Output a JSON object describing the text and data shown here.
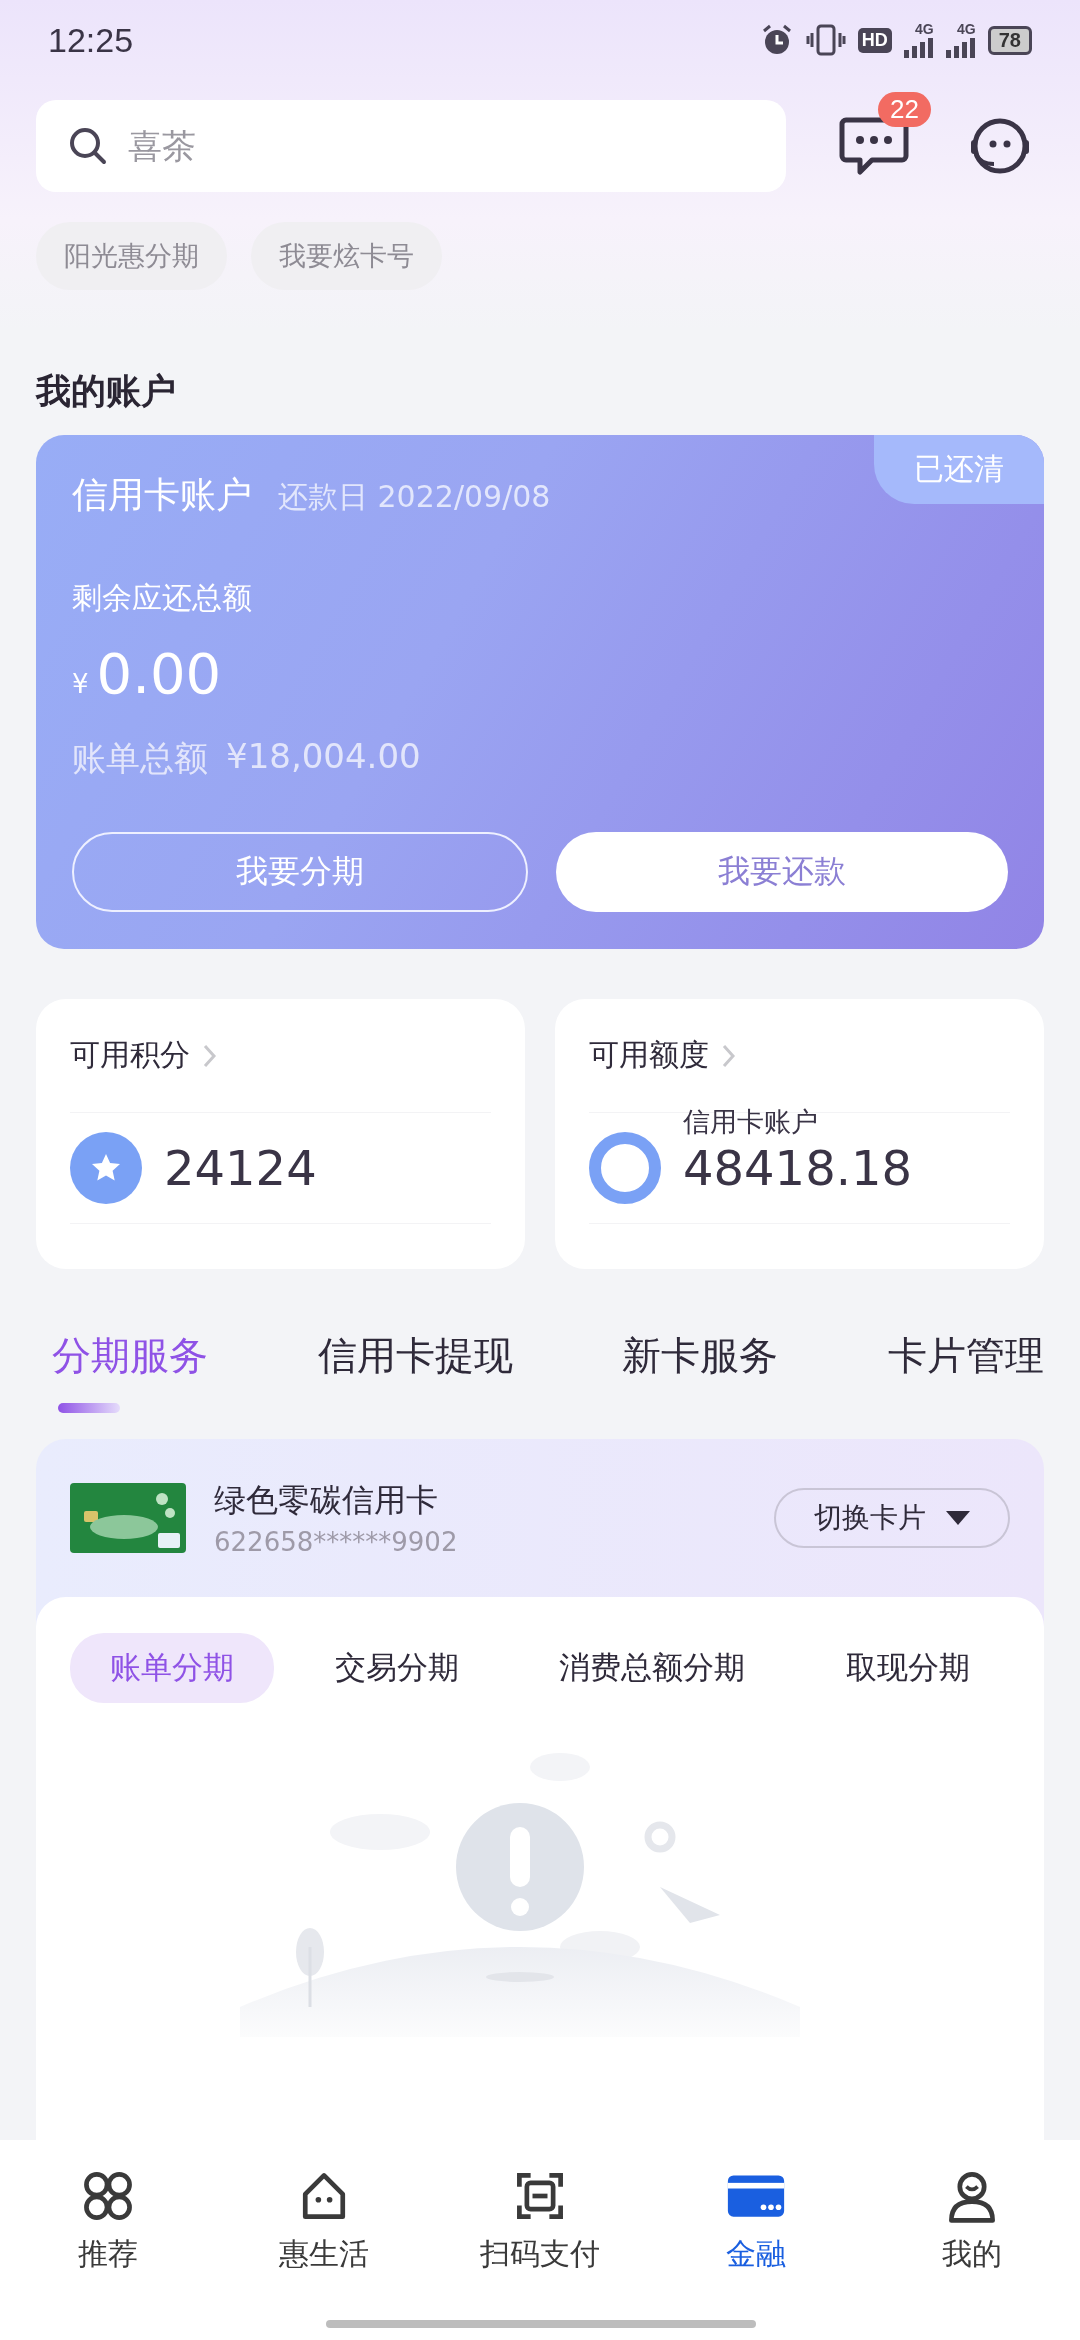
{
  "status_bar": {
    "time": "12:25",
    "hd": "HD",
    "network": [
      "4G",
      "4G"
    ],
    "battery": "78"
  },
  "search": {
    "placeholder": "喜茶"
  },
  "messages": {
    "badge": "22"
  },
  "chips": [
    "阳光惠分期",
    "我要炫卡号"
  ],
  "account": {
    "section_title": "我的账户",
    "title": "信用卡账户",
    "due": "还款日 2022/09/08",
    "status": "已还清",
    "remaining_label": "剩余应还总额",
    "currency": "¥",
    "amount": "0.00",
    "bill_label": "账单总额",
    "bill_amount": "¥18,004.00",
    "buttons": [
      {
        "label": "我要分期",
        "kind": "outline"
      },
      {
        "label": "我要还款",
        "kind": "filled"
      }
    ]
  },
  "stats": [
    {
      "label": "可用积分",
      "value": "24124",
      "kind": "points"
    },
    {
      "label": "可用额度",
      "sublabel": "信用卡账户",
      "value": "48418.18",
      "kind": "credit"
    }
  ],
  "tabs": [
    {
      "label": "分期服务",
      "selected": true
    },
    {
      "label": "信用卡提现",
      "selected": false
    },
    {
      "label": "新卡服务",
      "selected": false
    },
    {
      "label": "卡片管理",
      "selected": false
    }
  ],
  "card_panel": {
    "card_name": "绿色零碳信用卡",
    "card_number": "622658******9902",
    "switch_button": "切换卡片",
    "subtabs": [
      {
        "label": "账单分期",
        "selected": true
      },
      {
        "label": "交易分期",
        "selected": false
      },
      {
        "label": "消费总额分期",
        "selected": false
      },
      {
        "label": "取现分期",
        "selected": false
      }
    ]
  },
  "bottom_nav": [
    {
      "label": "推荐",
      "selected": false
    },
    {
      "label": "惠生活",
      "selected": false
    },
    {
      "label": "扫码支付",
      "selected": false
    },
    {
      "label": "金融",
      "selected": true
    },
    {
      "label": "我的",
      "selected": false
    }
  ]
}
